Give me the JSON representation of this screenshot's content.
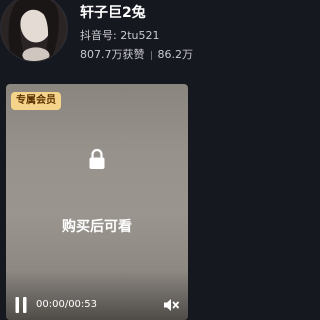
{
  "profile": {
    "name": "轩子巨2兔",
    "douyin_id": "抖音号: 2tu521",
    "likes": "807.7万获赞",
    "followers_partial": "86.2万"
  },
  "video": {
    "badge": "专属会员",
    "lock_icon": "lock-icon",
    "overlay_text": "购买后可看",
    "time": "00:00/00:53",
    "play_icon": "pause-icon",
    "mute_icon": "mute-icon"
  },
  "colors": {
    "background": "#16181f",
    "badge_bg": "#f6d38a",
    "badge_text": "#5a3300"
  }
}
